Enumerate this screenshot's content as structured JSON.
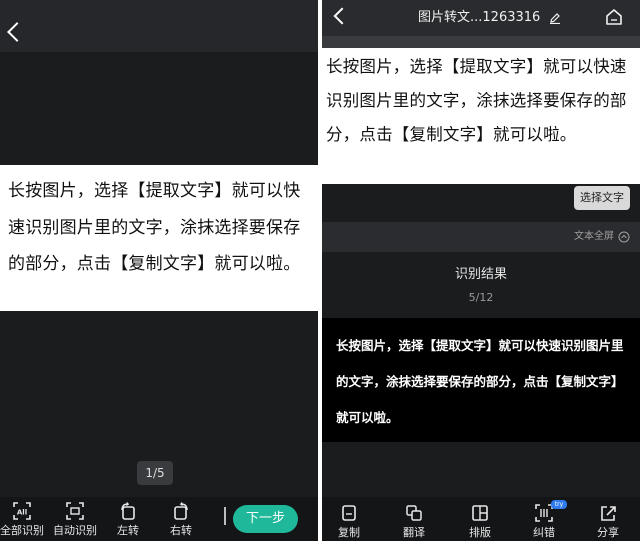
{
  "left": {
    "doc_text": "长按图片，选择【提取文字】就可以快速识别图片里的文字，涂抹选择要保存的部分，点击【复制文字】就可以啦。",
    "page_indicator": "1/5",
    "toolbar": [
      {
        "label": "全部识别",
        "icon": "all-recognize-icon"
      },
      {
        "label": "自动识别",
        "icon": "auto-recognize-icon"
      },
      {
        "label": "左转",
        "icon": "rotate-left-icon"
      },
      {
        "label": "右转",
        "icon": "rotate-right-icon"
      }
    ],
    "next_label": "下一步"
  },
  "right": {
    "title": "图片转文...1263316",
    "doc_text": "长按图片，选择【提取文字】就可以快速识别图片里的文字，涂抹选择要保存的部分，点击【复制文字】就可以啦。",
    "select_text_label": "选择文字",
    "fullscreen_label": "文本全屏",
    "result_title": "识别结果",
    "result_count": "5/12",
    "result_text": "长按图片，选择【提取文字】就可以快速识别图片里的文字，涂抹选择要保存的部分，点击【复制文字】就可以啦。",
    "toolbar": [
      {
        "label": "复制",
        "icon": "copy-icon"
      },
      {
        "label": "翻译",
        "icon": "translate-icon"
      },
      {
        "label": "排版",
        "icon": "layout-icon"
      },
      {
        "label": "纠错",
        "icon": "correct-icon"
      },
      {
        "label": "分享",
        "icon": "share-icon"
      }
    ],
    "beta_badge": "try"
  },
  "colors": {
    "accent": "#1fb89a",
    "badge": "#2f7bf0",
    "dark_bg": "#1b1c1e"
  }
}
